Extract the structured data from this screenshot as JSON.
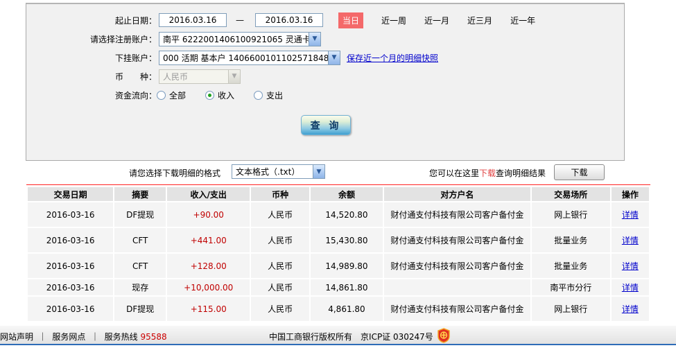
{
  "form": {
    "date_range": {
      "label": "起止日期：",
      "start": "2016.03.16",
      "end": "2016.03.16",
      "separator": "—"
    },
    "quick_ranges": {
      "today": "当日",
      "week": "近一周",
      "month": "近一月",
      "quarter": "近三月",
      "year": "近一年"
    },
    "register_account": {
      "label": "请选择注册账户：",
      "value": "南平 6222001406100921065 灵通卡"
    },
    "sub_account": {
      "label": "下挂账户：",
      "value": "000 活期 基本户 1406600101102571848",
      "snapshot_link": "保存近一个月的明细快照"
    },
    "currency": {
      "label": "币　　种：",
      "value": "人民币"
    },
    "fund_flow": {
      "label": "资金流向：",
      "options": [
        {
          "label": "全部",
          "selected": false
        },
        {
          "label": "收入",
          "selected": true
        },
        {
          "label": "支出",
          "selected": false
        }
      ]
    },
    "query_button": "查 询"
  },
  "download": {
    "format_label": "请您选择下载明细的格式",
    "format_value": "文本格式（.txt）",
    "hint_prefix": "您可以在这里",
    "hint_highlight": "下载",
    "hint_suffix": "查询明细结果",
    "download_button": "下载"
  },
  "table": {
    "headers": [
      "交易日期",
      "摘要",
      "收入/支出",
      "币种",
      "余额",
      "对方户名",
      "交易场所",
      "操作"
    ],
    "rows": [
      {
        "date": "2016-03-16",
        "summary": "DF提现",
        "amount": "+90.00",
        "currency": "人民币",
        "balance": "14,520.80",
        "counterparty": "财付通支付科技有限公司客户备付金",
        "place": "网上银行",
        "action": "详情"
      },
      {
        "date": "2016-03-16",
        "summary": "CFT",
        "amount": "+441.00",
        "currency": "人民币",
        "balance": "15,430.80",
        "counterparty": "财付通支付科技有限公司客户备付金",
        "place": "批量业务",
        "action": "详情"
      },
      {
        "date": "2016-03-16",
        "summary": "CFT",
        "amount": "+128.00",
        "currency": "人民币",
        "balance": "14,989.80",
        "counterparty": "财付通支付科技有限公司客户备付金",
        "place": "批量业务",
        "action": "详情"
      },
      {
        "date": "2016-03-16",
        "summary": "现存",
        "amount": "+10,000.00",
        "currency": "人民币",
        "balance": "14,861.80",
        "counterparty": "",
        "place": "南平市分行",
        "action": "详情"
      },
      {
        "date": "2016-03-16",
        "summary": "DF提现",
        "amount": "+115.00",
        "currency": "人民币",
        "balance": "4,861.80",
        "counterparty": "财付通支付科技有限公司客户备付金",
        "place": "网上银行",
        "action": "详情"
      }
    ]
  },
  "footer": {
    "links": [
      "网站声明",
      "服务网点",
      "服务热线"
    ],
    "divider": "｜",
    "hotline_number": "95588",
    "copyright": "中国工商银行版权所有",
    "icp": "京ICP证 030247号",
    "badge": "icbc-shield-badge"
  },
  "colors": {
    "accent_red": "#f4696a",
    "amount_red": "#c00000",
    "link_blue": "#0000cc",
    "button_blue": "#3fa0d0",
    "footer_line_blue": "#2e6cb8"
  }
}
